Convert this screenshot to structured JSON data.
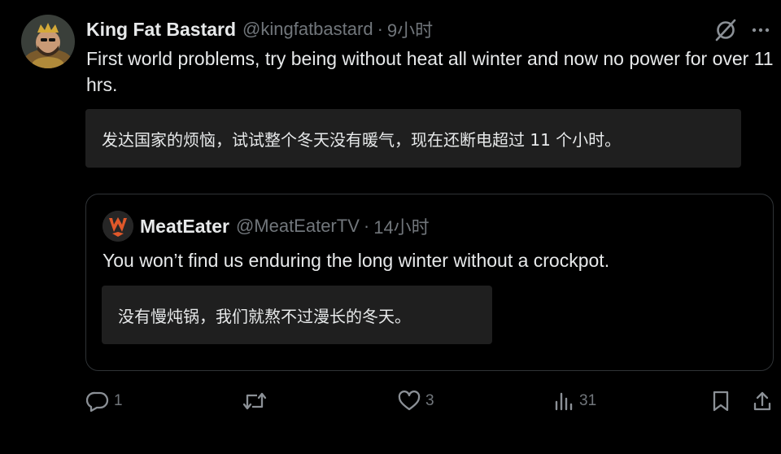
{
  "author": {
    "name": "King Fat Bastard",
    "handle": "@kingfatbastard",
    "separator": "·",
    "time": "9小时"
  },
  "tweet": {
    "text": "First world problems, try being without heat all winter and now no power for over 11 hrs.",
    "translation": "发达国家的烦恼，试试整个冬天没有暖气，现在还断电超过 11 个小时。"
  },
  "quoted": {
    "name": "MeatEater",
    "handle": "@MeatEaterTV",
    "separator": "·",
    "time": "14小时",
    "text": "You won’t find us enduring the long winter without a crockpot.",
    "translation": "没有慢炖锅，我们就熬不过漫长的冬天。"
  },
  "actions": {
    "replies": "1",
    "retweets": "",
    "likes": "3",
    "views": "31"
  },
  "icons": {
    "grok": "grok-icon",
    "more": "more-icon",
    "reply": "reply-icon",
    "retweet": "retweet-icon",
    "like": "heart-icon",
    "views": "views-icon",
    "bookmark": "bookmark-icon",
    "share": "share-icon"
  },
  "colors": {
    "background": "#000000",
    "text": "#e7e9ea",
    "secondary": "#71767b",
    "translation_bg": "#1f1f1f",
    "border": "#2f3336",
    "meateater_brand": "#e0582a"
  }
}
